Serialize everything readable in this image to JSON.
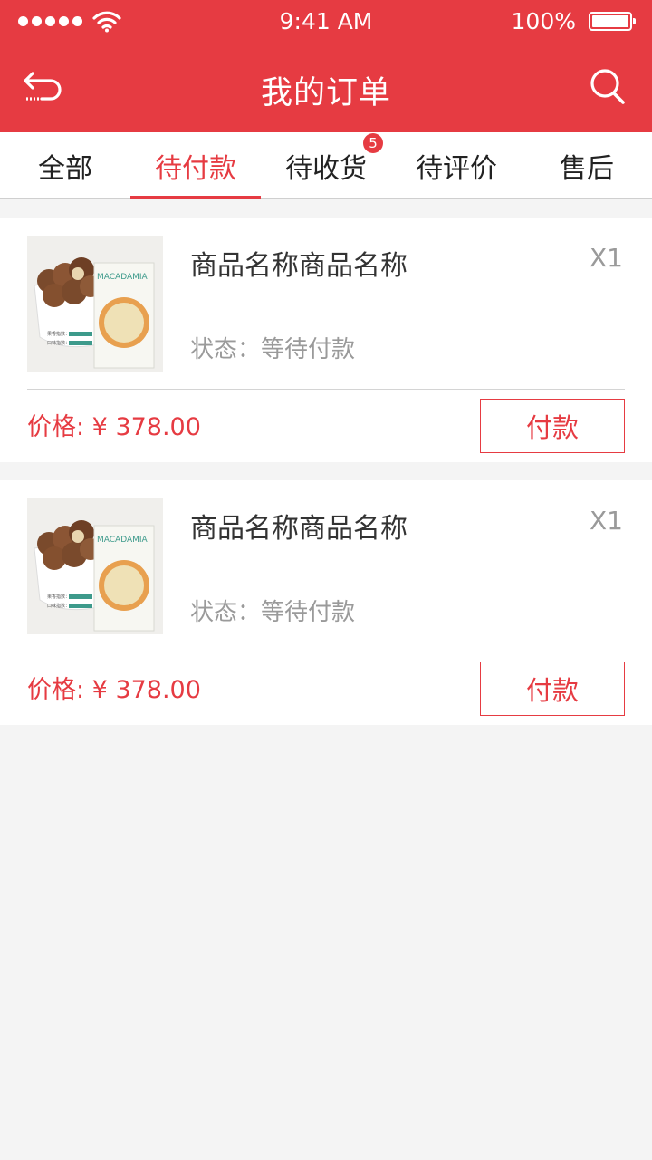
{
  "status_bar": {
    "time": "9:41 AM",
    "battery": "100%"
  },
  "header": {
    "title": "我的订单",
    "back_icon": "back-arrow-icon",
    "search_icon": "search-icon"
  },
  "tabs": [
    {
      "label": "全部",
      "active": false
    },
    {
      "label": "待付款",
      "active": true
    },
    {
      "label": "待收货",
      "active": false,
      "badge": "5"
    },
    {
      "label": "待评价",
      "active": false
    },
    {
      "label": "售后",
      "active": false
    }
  ],
  "orders": [
    {
      "name": "商品名称商品名称",
      "quantity": "X1",
      "status": "状态：等待付款",
      "price": "价格: ¥ 378.00",
      "action": "付款",
      "thumb_text": {
        "brand": "MACADAMIA",
        "line1": "果香指数：",
        "line2": "口味指数："
      }
    },
    {
      "name": "商品名称商品名称",
      "quantity": "X1",
      "status": "状态：等待付款",
      "price": "价格: ¥ 378.00",
      "action": "付款",
      "thumb_text": {
        "brand": "MACADAMIA",
        "line1": "果香指数：",
        "line2": "口味指数："
      }
    }
  ],
  "colors": {
    "accent": "#e63b42",
    "background": "#f4f4f4",
    "muted_text": "#9a9a9a"
  }
}
